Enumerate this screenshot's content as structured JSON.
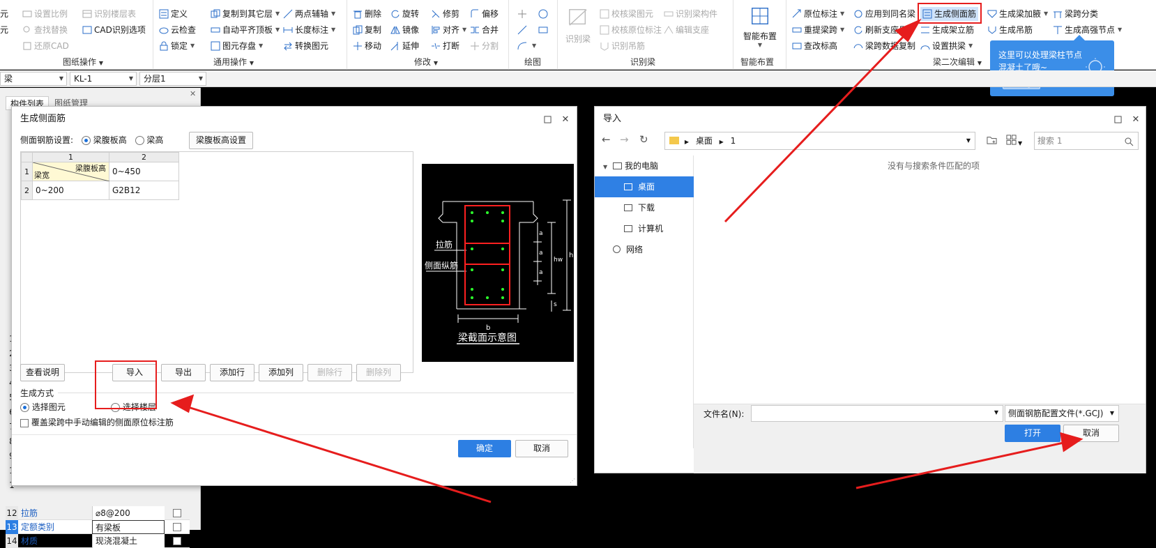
{
  "ribbon": {
    "g1": {
      "items": [
        "元",
        "设置比例",
        "识别楼层表",
        "元",
        "查找替换",
        "CAD识别选项",
        "还原CAD"
      ],
      "label": "图纸操作"
    },
    "g2": {
      "items": [
        "定义",
        "复制到其它层",
        "两点辅轴",
        "云检查",
        "自动平齐顶板",
        "长度标注",
        "锁定",
        "图元存盘",
        "转换图元"
      ],
      "label": "通用操作"
    },
    "g3": {
      "items": [
        "删除",
        "旋转",
        "修剪",
        "偏移",
        "复制",
        "镜像",
        "对齐",
        "合并",
        "移动",
        "延伸",
        "打断",
        "分割"
      ],
      "label": "修改"
    },
    "g4": {
      "label": "绘图"
    },
    "g5": {
      "big": "识别梁",
      "items": [
        "校核梁图元",
        "识别梁构件",
        "校核原位标注",
        "编辑支座",
        "识别吊筋"
      ],
      "label": "识别梁"
    },
    "g6": {
      "big": "智能布置",
      "label": "智能布置"
    },
    "g7": {
      "items": [
        "原位标注",
        "应用到同名梁",
        "生成侧面筋",
        "生成梁加腋",
        "梁跨分类",
        "重提梁跨",
        "刷新支座尺寸",
        "生成架立筋",
        "生成吊筋",
        "生成高强节点",
        "查改标高",
        "梁跨数据复制",
        "设置拱梁"
      ],
      "label": "梁二次编辑"
    }
  },
  "tooltip": {
    "line1": "这里可以处理梁柱节点",
    "line2": "混凝土了哦~",
    "btn": "知道了"
  },
  "toolbar2": {
    "sel1": "梁",
    "sel2": "KL-1",
    "sel3": "分层1"
  },
  "left_panel": {
    "tab1": "构件列表",
    "tab2": "图纸管理",
    "rows": [
      {
        "n": "12",
        "k": "拉筋",
        "v": "⌀8@200"
      },
      {
        "n": "13",
        "k": "定额类别",
        "v": "有梁板"
      },
      {
        "n": "14",
        "k": "材质",
        "v": "现浇混凝土"
      }
    ],
    "row_nums": [
      "1",
      "2",
      "3",
      "4",
      "5",
      "6",
      "7",
      "8",
      "9",
      "1",
      "1"
    ]
  },
  "side_dialog": {
    "title": "生成侧面筋",
    "setting_label": "侧面钢筋设置:",
    "radio1": "梁腹板高",
    "radio2": "梁高",
    "setting_btn": "梁腹板高设置",
    "table": {
      "col1": "1",
      "col2": "2",
      "header_top": "梁腹板高",
      "header_bottom": "梁宽",
      "header_value": "0~450",
      "row2_num": "2",
      "row2_width": "0~200",
      "row2_value": "G2B12",
      "row1_num": "1"
    },
    "btn_help": "查看说明",
    "btn_import": "导入",
    "btn_export": "导出",
    "btn_add_row": "添加行",
    "btn_add_col": "添加列",
    "btn_del_row": "删除行",
    "btn_del_col": "删除列",
    "mode_label": "生成方式",
    "mode1": "选择图元",
    "mode2": "选择楼层",
    "overwrite": "覆盖梁跨中手动编辑的侧面原位标注筋",
    "ok": "确定",
    "cancel": "取消",
    "diagram": {
      "label_tie": "拉筋",
      "label_side": "侧面纵筋",
      "caption": "梁截面示意图",
      "b": "b",
      "h": "h",
      "hw": "hw",
      "a": "a",
      "s": "s"
    }
  },
  "import_dialog": {
    "title": "导入",
    "path_root": "桌面",
    "path_sub": "1",
    "search_placeholder": "搜索 1",
    "nav": [
      "我的电脑",
      "桌面",
      "下载",
      "计算机",
      "网络"
    ],
    "empty_msg": "没有与搜索条件匹配的项",
    "filename_label": "文件名(N):",
    "filetype": "侧面钢筋配置文件(*.GCJ)",
    "open": "打开",
    "cancel": "取消"
  }
}
